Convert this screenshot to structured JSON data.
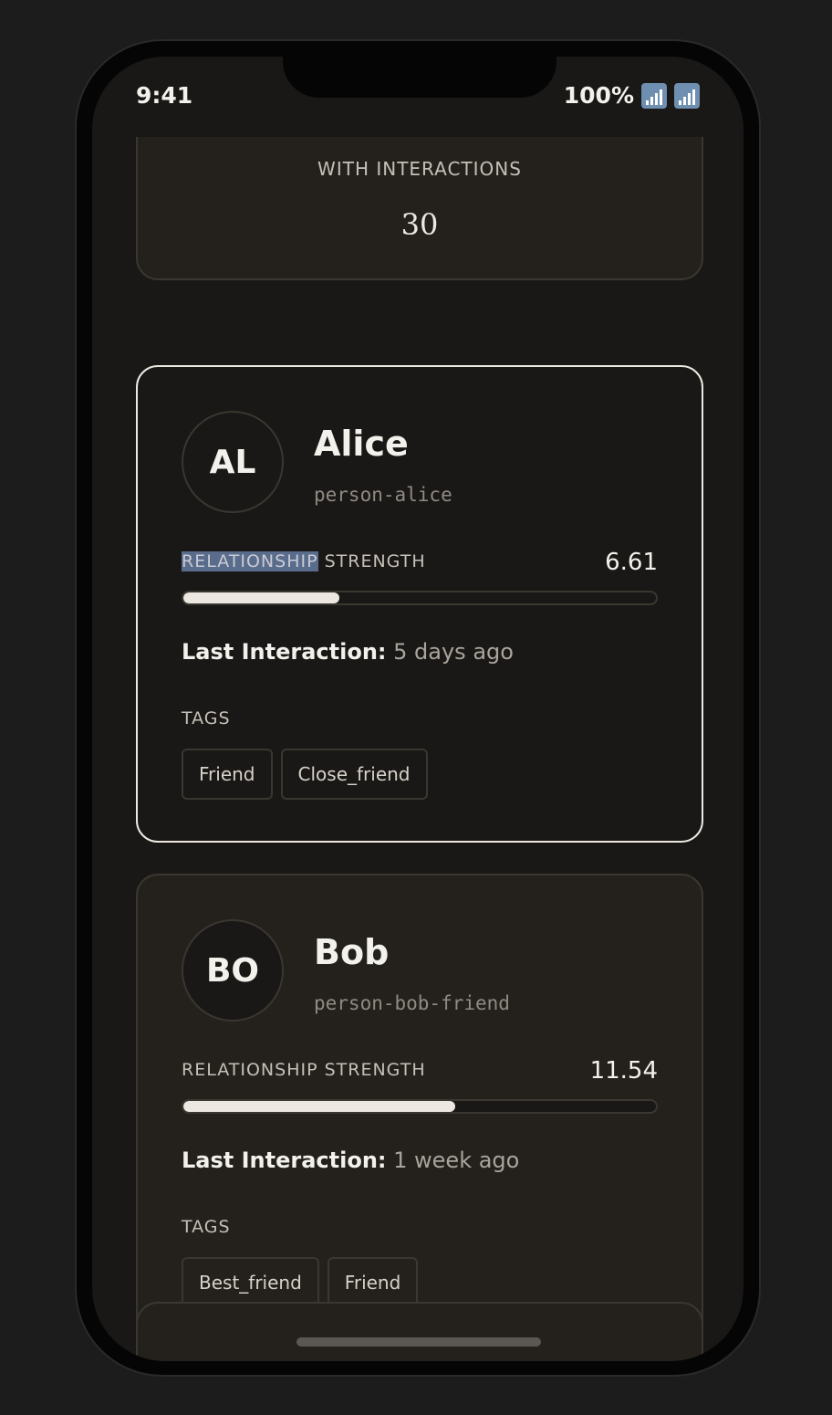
{
  "status": {
    "time": "9:41",
    "battery": "100%",
    "icons": [
      "signal-icon",
      "signal-icon"
    ]
  },
  "stat": {
    "label": "WITH INTERACTIONS",
    "value": "30"
  },
  "people": [
    {
      "initials": "AL",
      "name": "Alice",
      "handle": "person-alice",
      "strength_label_highlight": "RELATIONSHIP",
      "strength_label_rest": " STRENGTH",
      "strength": "6.61",
      "strength_fraction": 0.33,
      "last_label": "Last Interaction:",
      "last_value": "5 days ago",
      "tags_label": "TAGS",
      "tags": [
        "Friend",
        "Close_friend"
      ]
    },
    {
      "initials": "BO",
      "name": "Bob",
      "handle": "person-bob-friend",
      "strength_label": "RELATIONSHIP STRENGTH",
      "strength": "11.54",
      "strength_fraction": 0.575,
      "last_label": "Last Interaction:",
      "last_value": "1 week ago",
      "tags_label": "TAGS",
      "tags": [
        "Best_friend",
        "Friend"
      ]
    }
  ],
  "colors": {
    "background": "#1a1816",
    "card": "#24211d",
    "border": "#3a3630",
    "accent": "#ece8e1",
    "highlight": "#5a6c8c"
  }
}
